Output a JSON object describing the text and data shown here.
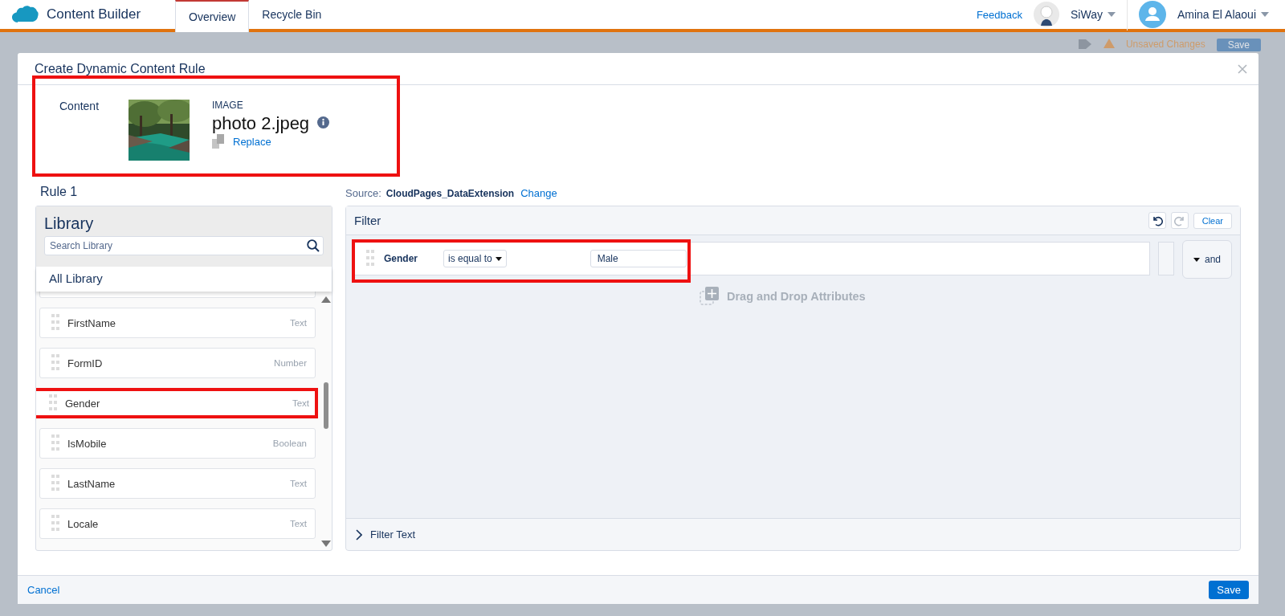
{
  "app": {
    "title": "Content Builder",
    "tabs": [
      {
        "label": "Overview",
        "selected": true
      },
      {
        "label": "Recycle Bin",
        "selected": false
      }
    ],
    "feedback": "Feedback",
    "org": "SiWay",
    "user": "Amina El Alaoui"
  },
  "background": {
    "status": "Unsaved Changes",
    "save": "Save"
  },
  "dialog": {
    "title": "Create Dynamic Content Rule",
    "content": {
      "label": "Content",
      "kind": "picture",
      "type": "IMAGE",
      "name": "photo 2.jpeg",
      "replace": "Replace",
      "highlighted": true
    },
    "rule_title": "Rule 1",
    "source": {
      "label": "Source:",
      "name": "CloudPages_DataExtension",
      "change": "Change"
    },
    "library": {
      "title": "Library",
      "search_placeholder": "Search Library",
      "dropdown": "All Library",
      "items": [
        {
          "name": "FirstName",
          "type": "Text",
          "highlighted": false
        },
        {
          "name": "FormID",
          "type": "Number",
          "highlighted": false
        },
        {
          "name": "Gender",
          "type": "Text",
          "highlighted": true
        },
        {
          "name": "IsMobile",
          "type": "Boolean",
          "highlighted": false
        },
        {
          "name": "LastName",
          "type": "Text",
          "highlighted": false
        },
        {
          "name": "Locale",
          "type": "Text",
          "highlighted": false
        }
      ]
    },
    "filter": {
      "title": "Filter",
      "clear": "Clear",
      "conditions": [
        {
          "field": "Gender",
          "operator": "is equal to",
          "value": "Male",
          "highlighted": true
        }
      ],
      "conjunction": "and",
      "drop_hint": "Drag and Drop Attributes",
      "filter_text": "Filter Text"
    },
    "cancel": "Cancel",
    "save": "Save"
  }
}
